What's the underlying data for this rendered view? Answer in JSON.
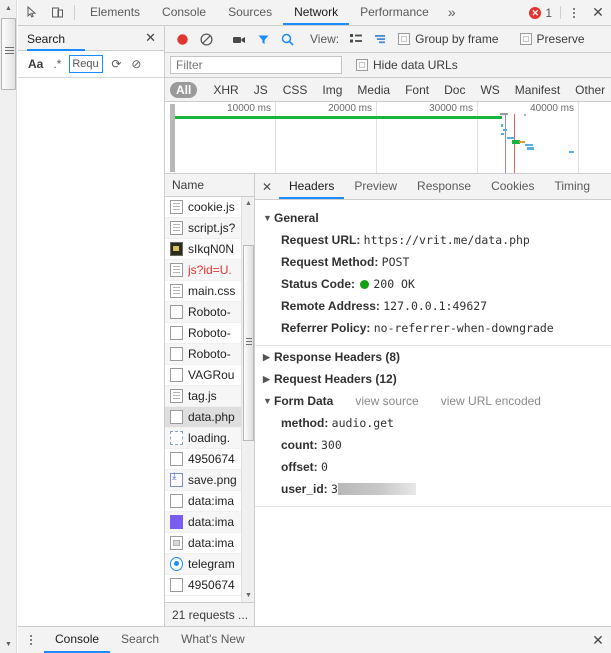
{
  "window": {
    "tabs": [
      {
        "label": "Elements",
        "active": false
      },
      {
        "label": "Console",
        "active": false
      },
      {
        "label": "Sources",
        "active": false
      },
      {
        "label": "Network",
        "active": true
      },
      {
        "label": "Performance",
        "active": false
      }
    ],
    "more_label": "»",
    "error_count": "1",
    "close_label": "✕"
  },
  "sidebar": {
    "title": "Search",
    "close_label": "✕",
    "tools": {
      "match_case": "Aa",
      "regex": ".*",
      "refresh": "⟳",
      "clear": "⊘"
    },
    "query_value": "Requ",
    "query_placeholder": ""
  },
  "network": {
    "toolbar": {
      "record_title": "record",
      "clear_title": "clear",
      "camera_title": "screenshots",
      "filter_title": "filter",
      "search_title": "search",
      "view_label": "View:",
      "group_by_frame": "Group by frame",
      "preserve_log": "Preserve"
    },
    "filter": {
      "placeholder": "Filter",
      "value": "",
      "hide_data_urls": "Hide data URLs"
    },
    "types": [
      "All",
      "XHR",
      "JS",
      "CSS",
      "Img",
      "Media",
      "Font",
      "Doc",
      "WS",
      "Manifest",
      "Other"
    ],
    "types_active": "All",
    "overview": {
      "ticks": [
        "10000 ms",
        "20000 ms",
        "30000 ms",
        "40000 ms"
      ]
    },
    "list": {
      "column_header": "Name",
      "footer": "21 requests ...",
      "rows": [
        {
          "name": "cookie.js",
          "icon": "doc",
          "state": "normal"
        },
        {
          "name": "script.js?",
          "icon": "doc",
          "state": "normal"
        },
        {
          "name": "sIkqN0N",
          "icon": "imgthumb",
          "state": "normal"
        },
        {
          "name": "js?id=U.",
          "icon": "doc",
          "state": "error"
        },
        {
          "name": "main.css",
          "icon": "doc",
          "state": "normal"
        },
        {
          "name": "Roboto-",
          "icon": "plain",
          "state": "normal"
        },
        {
          "name": "Roboto-",
          "icon": "plain",
          "state": "normal"
        },
        {
          "name": "Roboto-",
          "icon": "plain",
          "state": "normal"
        },
        {
          "name": "VAGRou",
          "icon": "plain",
          "state": "normal"
        },
        {
          "name": "tag.js",
          "icon": "doc",
          "state": "normal"
        },
        {
          "name": "data.php",
          "icon": "plain",
          "state": "selected"
        },
        {
          "name": "loading.",
          "icon": "dashed",
          "state": "normal"
        },
        {
          "name": "4950674",
          "icon": "plain",
          "state": "normal"
        },
        {
          "name": "save.png",
          "icon": "blue-dl",
          "state": "normal"
        },
        {
          "name": "data:ima",
          "icon": "plain",
          "state": "normal"
        },
        {
          "name": "data:ima",
          "icon": "purple",
          "state": "normal"
        },
        {
          "name": "data:ima",
          "icon": "smallimg",
          "state": "normal"
        },
        {
          "name": "telegram",
          "icon": "radio",
          "state": "normal"
        },
        {
          "name": "4950674",
          "icon": "plain",
          "state": "normal"
        }
      ]
    }
  },
  "details": {
    "close_label": "✕",
    "tabs": [
      {
        "label": "Headers",
        "active": true
      },
      {
        "label": "Preview",
        "active": false
      },
      {
        "label": "Response",
        "active": false
      },
      {
        "label": "Cookies",
        "active": false
      },
      {
        "label": "Timing",
        "active": false
      }
    ],
    "general": {
      "heading": "General",
      "rows": [
        {
          "key": "Request URL:",
          "value": "https://vrit.me/data.php"
        },
        {
          "key": "Request Method:",
          "value": "POST"
        },
        {
          "key": "Status Code:",
          "value": "200 OK",
          "dot": true
        },
        {
          "key": "Remote Address:",
          "value": "127.0.0.1:49627"
        },
        {
          "key": "Referrer Policy:",
          "value": "no-referrer-when-downgrade"
        }
      ]
    },
    "response_headers": "Response Headers (8)",
    "request_headers": "Request Headers (12)",
    "form_data": {
      "heading": "Form Data",
      "view_source": "view source",
      "view_url_encoded": "view URL encoded",
      "rows": [
        {
          "key": "method:",
          "value": "audio.get",
          "redacted": false
        },
        {
          "key": "count:",
          "value": "300",
          "redacted": false
        },
        {
          "key": "offset:",
          "value": "0",
          "redacted": false
        },
        {
          "key": "user_id:",
          "value": "3",
          "redacted": true
        }
      ]
    }
  },
  "drawer": {
    "tabs": [
      {
        "label": "Console",
        "active": true
      },
      {
        "label": "Search",
        "active": false
      },
      {
        "label": "What's New",
        "active": false
      }
    ],
    "close_label": "✕"
  }
}
